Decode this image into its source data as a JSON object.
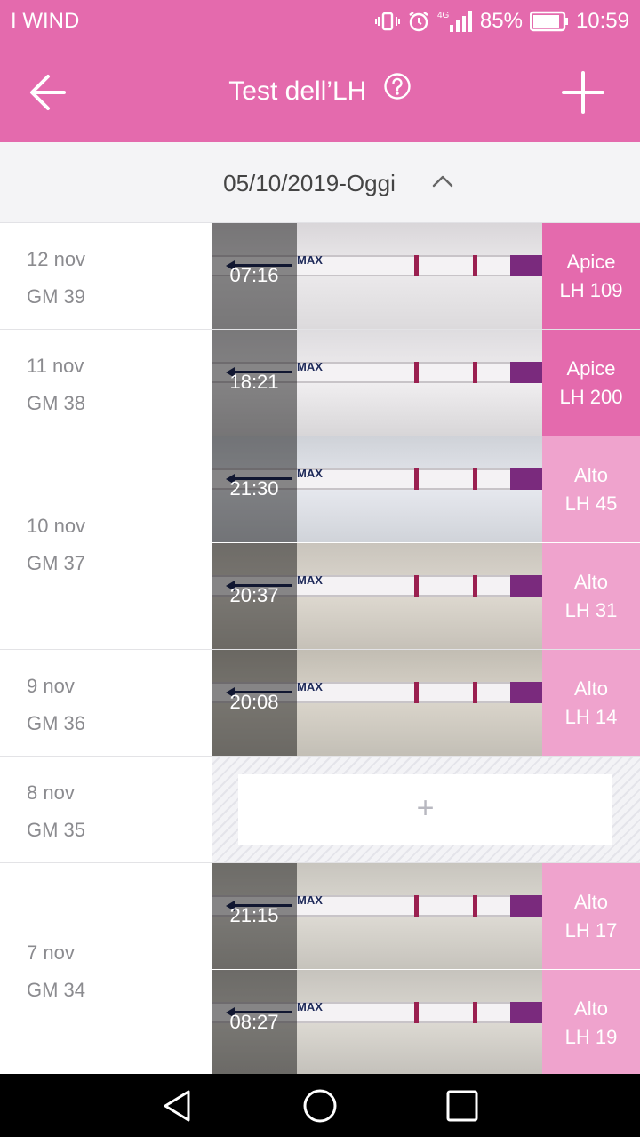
{
  "status_bar": {
    "carrier": "I WIND",
    "network": "4G",
    "battery": "85%",
    "time": "10:59",
    "icons": [
      "vibrate-icon",
      "alarm-icon",
      "signal-icon",
      "battery-icon"
    ]
  },
  "app_bar": {
    "title": "Test dell’LH",
    "back_icon": "arrow-left-icon",
    "help_icon": "question-circle-icon",
    "add_icon": "plus-icon"
  },
  "range": {
    "label": "05/10/2019-Oggi",
    "icon": "chevron-up-icon"
  },
  "strip_text": "MAX",
  "days": [
    {
      "date": "12 nov",
      "cycle_day": "GM 39",
      "entries": [
        {
          "time": "07:16",
          "level": "Apice",
          "value": "LH 109"
        }
      ]
    },
    {
      "date": "11 nov",
      "cycle_day": "GM 38",
      "entries": [
        {
          "time": "18:21",
          "level": "Apice",
          "value": "LH 200"
        }
      ]
    },
    {
      "date": "10 nov",
      "cycle_day": "GM 37",
      "entries": [
        {
          "time": "21:30",
          "level": "Alto",
          "value": "LH 45"
        },
        {
          "time": "20:37",
          "level": "Alto",
          "value": "LH 31"
        }
      ]
    },
    {
      "date": "9 nov",
      "cycle_day": "GM 36",
      "entries": [
        {
          "time": "20:08",
          "level": "Alto",
          "value": "LH 14"
        }
      ]
    },
    {
      "date": "8 nov",
      "cycle_day": "GM 35",
      "empty_label": "+",
      "entries": []
    },
    {
      "date": "7 nov",
      "cycle_day": "GM 34",
      "entries": [
        {
          "time": "21:15",
          "level": "Alto",
          "value": "LH 17"
        },
        {
          "time": "08:27",
          "level": "Alto",
          "value": "LH 19"
        }
      ]
    }
  ],
  "colors": {
    "brand_pink": "#e46aad",
    "peak": "#e46aad",
    "high": "#efa3cd"
  },
  "nav_bar": {
    "icons": [
      "back-triangle-icon",
      "home-circle-icon",
      "recents-square-icon"
    ]
  }
}
